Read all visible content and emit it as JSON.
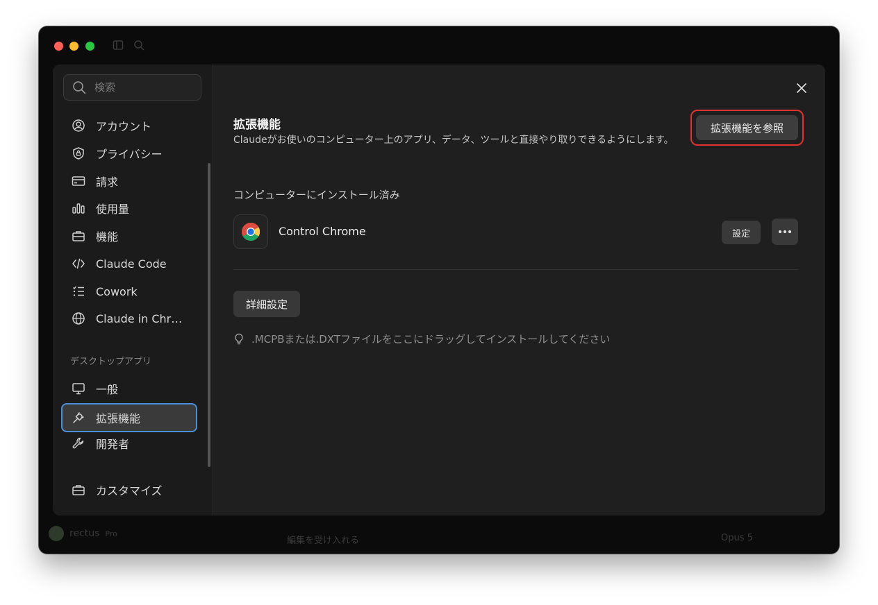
{
  "background": {
    "user_name": "rectus",
    "plan": "Pro",
    "input_placeholder": "編集を受け入れる",
    "model": "Opus 5"
  },
  "search": {
    "placeholder": "検索"
  },
  "sidebar": {
    "items": [
      {
        "label": "アカウント",
        "icon": "user-circle-icon"
      },
      {
        "label": "プライバシー",
        "icon": "shield-lock-icon"
      },
      {
        "label": "請求",
        "icon": "credit-card-icon"
      },
      {
        "label": "使用量",
        "icon": "bar-chart-icon"
      },
      {
        "label": "機能",
        "icon": "toolbox-icon"
      },
      {
        "label": "Claude Code",
        "icon": "code-icon"
      },
      {
        "label": "Cowork",
        "icon": "checklist-icon"
      },
      {
        "label": "Claude in Chr…",
        "icon": "globe-icon"
      }
    ],
    "section_label": "デスクトップアプリ",
    "desktop_items": [
      {
        "label": "一般",
        "icon": "monitor-icon"
      },
      {
        "label": "拡張機能",
        "icon": "plug-icon",
        "active": true
      },
      {
        "label": "開発者",
        "icon": "wrench-icon"
      }
    ],
    "bottom_item": {
      "label": "カスタマイズ",
      "icon": "briefcase-icon"
    }
  },
  "main": {
    "title": "拡張機能",
    "description": "Claudeがお使いのコンピューター上のアプリ、データ、ツールと直接やり取りできるようにします。",
    "browse_button": "拡張機能を参照",
    "installed_heading": "コンピューターにインストール済み",
    "extension": {
      "name": "Control Chrome",
      "settings_button": "設定"
    },
    "advanced_button": "詳細設定",
    "hint": ".MCPBまたは.DXTファイルをここにドラッグしてインストールしてください"
  },
  "colors": {
    "highlight_outline": "#e0322f",
    "active_border": "#4a90d9"
  }
}
